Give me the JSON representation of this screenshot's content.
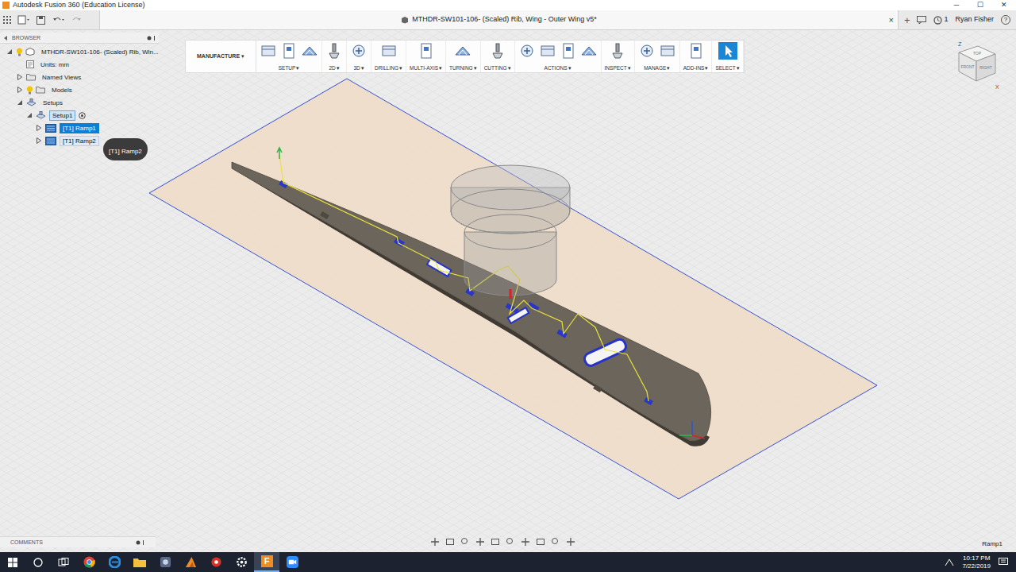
{
  "window": {
    "title": "Autodesk Fusion 360 (Education License)",
    "controls": [
      "─",
      "☐",
      "✕"
    ]
  },
  "document_tab": {
    "title": "MTHDR-SW101-106- (Scaled) Rib, Wing - Outer Wing v5*",
    "close": "×",
    "new_tab": "+"
  },
  "account": {
    "jobs": "1",
    "user": "Ryan Fisher",
    "help": "?"
  },
  "toolbar": {
    "workspace": "MANUFACTURE",
    "arrow": "▾",
    "groups": [
      {
        "label": "SETUP",
        "selected": false
      },
      {
        "label": "2D",
        "selected": false
      },
      {
        "label": "3D",
        "selected": false
      },
      {
        "label": "DRILLING",
        "selected": false
      },
      {
        "label": "MULTI-AXIS",
        "selected": false
      },
      {
        "label": "TURNING",
        "selected": false
      },
      {
        "label": "CUTTING",
        "selected": false
      },
      {
        "label": "ACTIONS",
        "selected": false
      },
      {
        "label": "INSPECT",
        "selected": false
      },
      {
        "label": "MANAGE",
        "selected": false
      },
      {
        "label": "ADD-INS",
        "selected": false
      },
      {
        "label": "SELECT",
        "selected": true
      }
    ]
  },
  "browser": {
    "title": "BROWSER",
    "items": [
      {
        "label": "MTHDR-SW101-106- (Scaled) Rib, Win...",
        "kind": "document",
        "depth": 0,
        "expandable": true,
        "expanded": true,
        "selected": false,
        "active": false,
        "hovered": false
      },
      {
        "label": "Units: mm",
        "kind": "units",
        "depth": 1,
        "expandable": false,
        "expanded": false,
        "selected": false,
        "active": false,
        "hovered": false
      },
      {
        "label": "Named Views",
        "kind": "folder",
        "depth": 1,
        "expandable": true,
        "expanded": false,
        "selected": false,
        "active": false,
        "hovered": false
      },
      {
        "label": "Models",
        "kind": "models",
        "depth": 1,
        "expandable": true,
        "expanded": false,
        "selected": false,
        "active": false,
        "hovered": false
      },
      {
        "label": "Setups",
        "kind": "setups",
        "depth": 1,
        "expandable": true,
        "expanded": true,
        "selected": false,
        "active": false,
        "hovered": false
      },
      {
        "label": "Setup1",
        "kind": "setup",
        "depth": 2,
        "expandable": true,
        "expanded": true,
        "selected": false,
        "active": true,
        "hovered": false
      },
      {
        "label": "[T1] Ramp1",
        "kind": "operation",
        "depth": 3,
        "expandable": true,
        "expanded": false,
        "selected": true,
        "active": false,
        "hovered": false
      },
      {
        "label": "[T1] Ramp2",
        "kind": "operation",
        "depth": 3,
        "expandable": true,
        "expanded": false,
        "selected": false,
        "active": false,
        "hovered": true
      }
    ]
  },
  "tooltip": {
    "text": "[T1] Ramp2"
  },
  "viewcube": {
    "top": "TOP",
    "front": "FRONT",
    "right": "RIGHT",
    "z_axis": "Z",
    "x_axis": "X"
  },
  "comments": {
    "title": "COMMENTS"
  },
  "status_bar": {
    "text": "Ramp1"
  },
  "taskbar": {
    "fusion_logo": "F",
    "time": "10:17 PM",
    "date": "7/22/2019"
  }
}
